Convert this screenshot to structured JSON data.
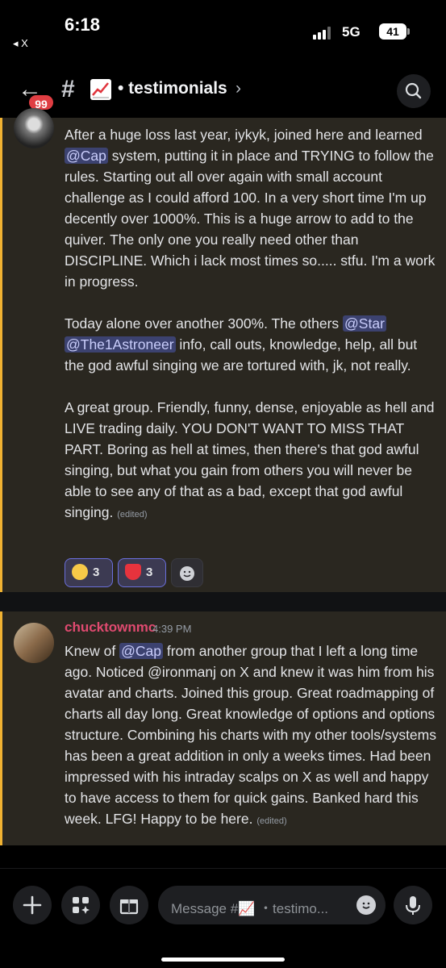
{
  "status": {
    "time": "6:18",
    "back_app": "◂ X",
    "network": "5G",
    "battery": "41"
  },
  "header": {
    "back_badge": "99",
    "hash": "#",
    "channel_name": "• testimonials",
    "chevron": "›"
  },
  "messages": [
    {
      "author": "",
      "paragraphs": [
        [
          "After a huge loss last year,  iykyk, joined here and learned ",
          {
            "mention": "@Cap"
          },
          "  system, putting it in place and TRYING to follow the rules. Starting out all over again with small account challenge as I could afford 100.  In a very short time I'm up decently over 1000%.  This is a huge arrow to add to the quiver.   The only one you really need other than DISCIPLINE.   Which i lack most times so..... stfu. I'm a work in progress."
        ],
        [
          "Today alone over another 300%.  The others ",
          {
            "mention": "@Star"
          },
          " ",
          {
            "mention": "@The1Astroneer"
          },
          " info, call outs, knowledge,  help,  all but the god awful singing we are tortured with,  jk, not really."
        ],
        [
          "   A great group.  Friendly,  funny,  dense,  enjoyable as hell and LIVE trading daily.   YOU DON'T WANT TO MISS THAT PART.  Boring as hell at times,  then there's that god awful singing,  but what you gain from others you will never be able to see any of that as a bad, except that god awful singing. ",
          {
            "edited": "(edited)"
          }
        ]
      ],
      "reactions": [
        {
          "icon": "rofl-emoji-icon",
          "count": "3"
        },
        {
          "icon": "heart-emoji-icon",
          "count": "3"
        }
      ]
    },
    {
      "author": "chucktownmc",
      "timestamp": "4:39 PM",
      "paragraphs": [
        [
          "Knew of ",
          {
            "mention": "@Cap"
          },
          " from another group that I left a long time ago.  Noticed @ironmanj on X and knew it was him from his avatar and charts.  Joined this group.  Great roadmapping of charts all day long.  Great knowledge of options and options structure.  Combining his charts with my other tools/systems has been a great addition in only a weeks times.  Had been impressed with his intraday scalps on X as well and happy to have access to them for quick gains. Banked hard this week. LFG!  Happy to be here. ",
          {
            "edited": "(edited)"
          }
        ]
      ]
    }
  ],
  "composer": {
    "placeholder": "Message #📈 ・testimo..."
  },
  "colors": {
    "accent_bar": "#f0b232",
    "mention_bg": "#3c4270",
    "author": "#e04a70",
    "badge": "#e03e43"
  }
}
